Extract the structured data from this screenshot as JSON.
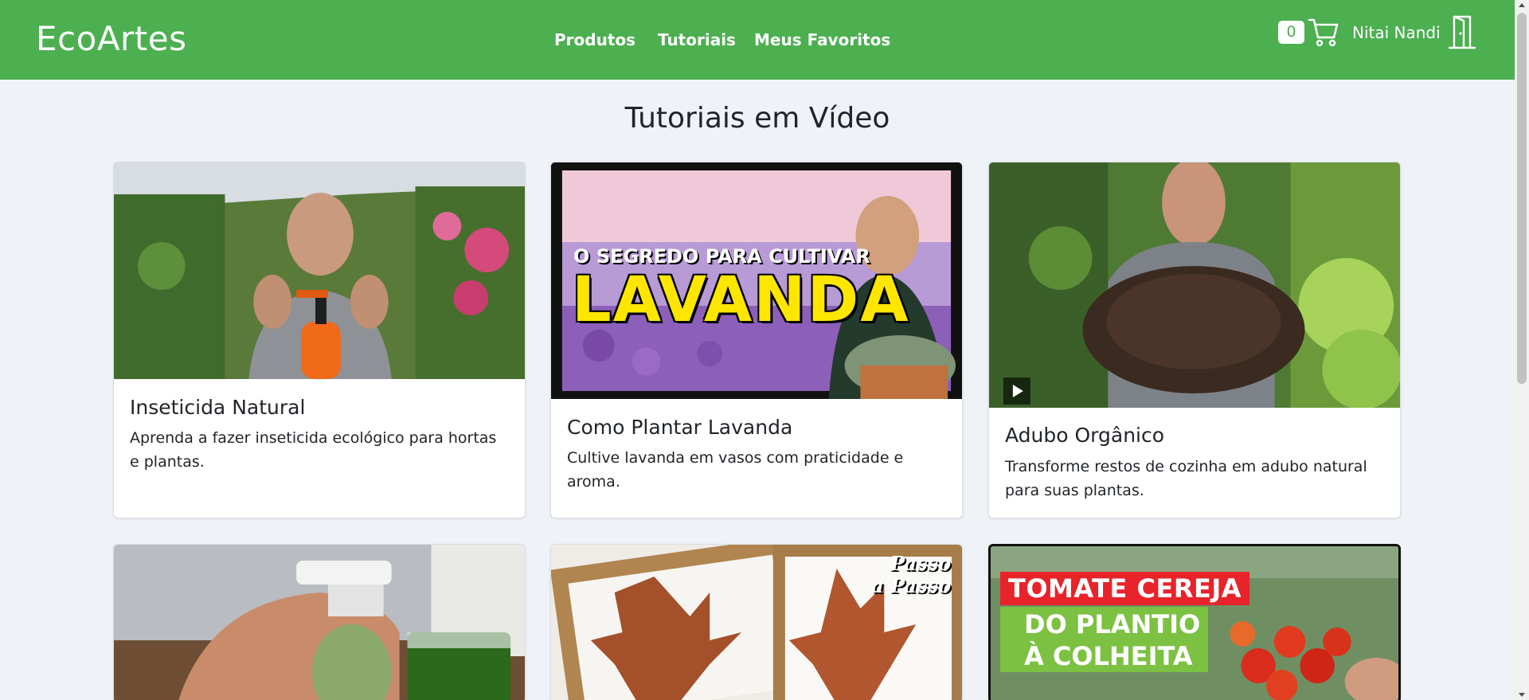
{
  "header": {
    "brand": "EcoArtes",
    "nav": [
      "Produtos",
      "Tutoriais",
      "Meus Favoritos"
    ],
    "cart_count": "0",
    "cart_icon": "cart-icon",
    "username": "Nitai Nandi",
    "logout_icon": "door-icon",
    "color": "#4caf50"
  },
  "page": {
    "title": "Tutoriais em Vídeo"
  },
  "tutorials": [
    {
      "title": "Inseticida Natural",
      "description": "Aprenda a fazer inseticida ecológico para hortas e plantas."
    },
    {
      "title": "Como Plantar Lavanda",
      "description": "Cultive lavanda em vasos com praticidade e aroma.",
      "thumb_text_top": "O SEGREDO PARA CULTIVAR",
      "thumb_text_main": "LAVANDA"
    },
    {
      "title": "Adubo Orgânico",
      "description": "Transforme restos de cozinha em adubo natural para suas plantas."
    },
    {
      "title": "",
      "description": ""
    },
    {
      "title": "",
      "description": "",
      "thumb_text_1": "Passo",
      "thumb_text_2": "a Passo"
    },
    {
      "title": "",
      "description": "",
      "thumb_text_1": "TOMATE CEREJA",
      "thumb_text_2": "DO PLANTIO",
      "thumb_text_3": "À COLHEITA"
    }
  ]
}
